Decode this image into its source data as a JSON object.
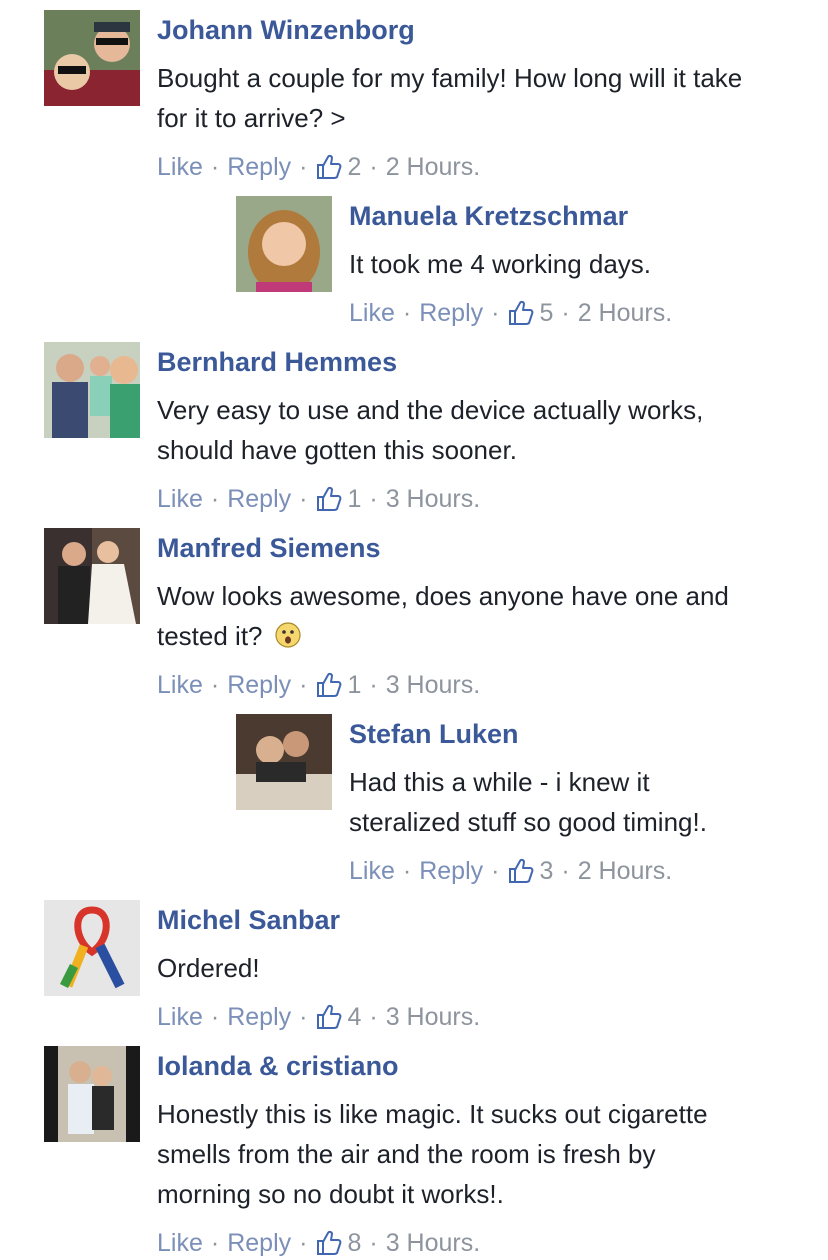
{
  "labels": {
    "like": "Like",
    "reply": "Reply",
    "dot": "·"
  },
  "colors": {
    "name": "#3b5998",
    "text": "#1d2129",
    "meta": "#8d949e",
    "link": "#7b8fb8"
  },
  "comments": [
    {
      "name": "Johann Winzenborg",
      "lines": [
        "Bought a couple for my family! How long will it take",
        "for it to arrive? >"
      ],
      "likes": "2",
      "time": "2 Hours.",
      "avatar": "couple-selfie"
    },
    {
      "name": "Manuela Kretzschmar",
      "lines": [
        "It took me 4 working days."
      ],
      "likes": "5",
      "time": "2 Hours.",
      "avatar": "woman-portrait"
    },
    {
      "name": "Bernhard Hemmes",
      "lines": [
        "Very easy to use and the device actually works,",
        "should have gotten this sooner."
      ],
      "likes": "1",
      "time": "3 Hours.",
      "avatar": "family-photo"
    },
    {
      "name": "Manfred Siemens",
      "lines": [
        "Wow looks awesome, does anyone have one and",
        "tested it?"
      ],
      "likes": "1",
      "time": "3 Hours.",
      "avatar": "wedding-photo",
      "emoji": "surprised-emoji"
    },
    {
      "name": "Stefan Luken",
      "lines": [
        "Had this a while - i knew it",
        "steralized stuff so good timing!."
      ],
      "likes": "3",
      "time": "2 Hours.",
      "avatar": "couple-indoor"
    },
    {
      "name": "Michel Sanbar",
      "lines": [
        "Ordered!"
      ],
      "likes": "4",
      "time": "3 Hours.",
      "avatar": "ribbon-logo"
    },
    {
      "name": "Iolanda & cristiano",
      "lines": [
        "Honestly this is like magic. It sucks out cigarette",
        "smells from the air and the room is fresh by",
        "morning so no doubt it works!."
      ],
      "likes": "8",
      "time": "3 Hours.",
      "avatar": "couple-dark"
    }
  ]
}
